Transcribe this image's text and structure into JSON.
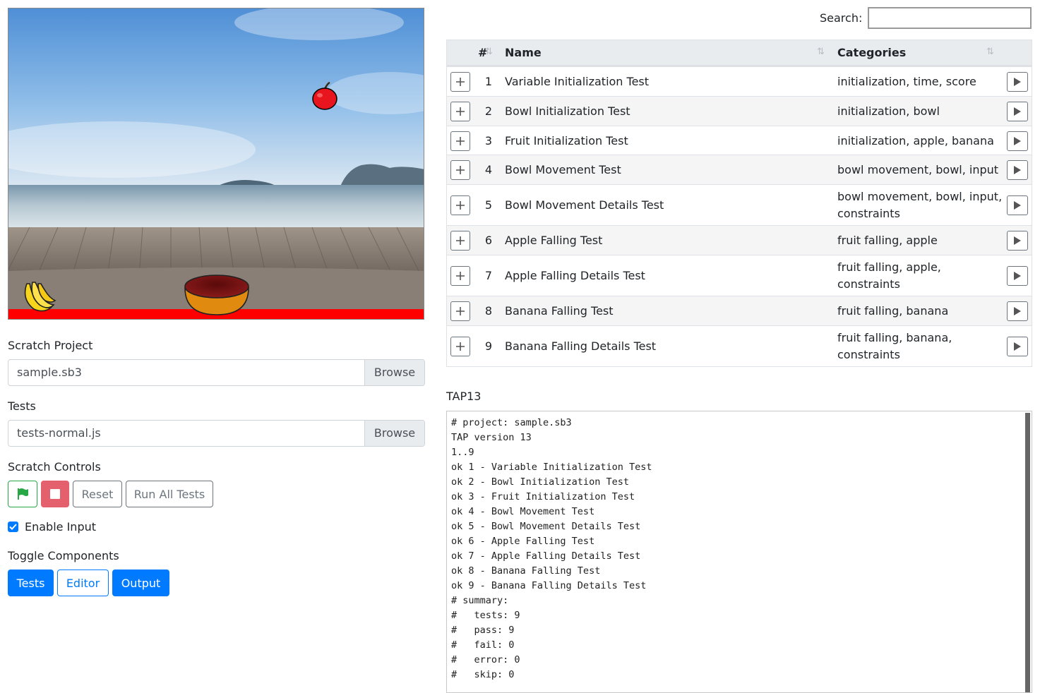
{
  "project": {
    "label": "Scratch Project",
    "file": "sample.sb3",
    "browse": "Browse"
  },
  "tests": {
    "label": "Tests",
    "file": "tests-normal.js",
    "browse": "Browse"
  },
  "controls": {
    "label": "Scratch Controls",
    "green_flag_icon": "green-flag-icon",
    "stop_icon": "stop-icon",
    "reset": "Reset",
    "run_all": "Run All Tests",
    "enable_input": "Enable Input",
    "enable_input_checked": true
  },
  "toggle": {
    "label": "Toggle Components",
    "tests": "Tests",
    "editor": "Editor",
    "output": "Output"
  },
  "search": {
    "label": "Search:",
    "value": ""
  },
  "table": {
    "columns": {
      "num": "#",
      "name": "Name",
      "categories": "Categories"
    },
    "rows": [
      {
        "num": "1",
        "name": "Variable Initialization Test",
        "categories": "initialization, time, score"
      },
      {
        "num": "2",
        "name": "Bowl Initialization Test",
        "categories": "initialization, bowl"
      },
      {
        "num": "3",
        "name": "Fruit Initialization Test",
        "categories": "initialization, apple, banana"
      },
      {
        "num": "4",
        "name": "Bowl Movement Test",
        "categories": "bowl movement, bowl, input"
      },
      {
        "num": "5",
        "name": "Bowl Movement Details Test",
        "categories": "bowl movement, bowl, input, constraints"
      },
      {
        "num": "6",
        "name": "Apple Falling Test",
        "categories": "fruit falling, apple"
      },
      {
        "num": "7",
        "name": "Apple Falling Details Test",
        "categories": "fruit falling, apple, constraints"
      },
      {
        "num": "8",
        "name": "Banana Falling Test",
        "categories": "fruit falling, banana"
      },
      {
        "num": "9",
        "name": "Banana Falling Details Test",
        "categories": "fruit falling, banana, constraints"
      }
    ]
  },
  "tap": {
    "label": "TAP13",
    "output": "# project: sample.sb3\nTAP version 13\n1..9\nok 1 - Variable Initialization Test\nok 2 - Bowl Initialization Test\nok 3 - Fruit Initialization Test\nok 4 - Bowl Movement Test\nok 5 - Bowl Movement Details Test\nok 6 - Apple Falling Test\nok 7 - Apple Falling Details Test\nok 8 - Banana Falling Test\nok 9 - Banana Falling Details Test\n# summary:\n#   tests: 9\n#   pass: 9\n#   fail: 0\n#   error: 0\n#   skip: 0"
  },
  "colors": {
    "primary": "#007bff",
    "success": "#28a745",
    "danger": "#e4606d",
    "secondary": "#6c757d"
  }
}
